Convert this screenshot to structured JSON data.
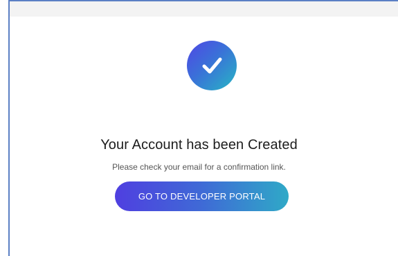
{
  "confirmation": {
    "icon": "checkmark-icon",
    "title": "Your Account has been Created",
    "message": "Please check your email for a confirmation link.",
    "button_label": "GO TO DEVELOPER PORTAL"
  },
  "colors": {
    "frame": "#5b7fc4",
    "gradient_start": "#5046e5",
    "gradient_end": "#27b6c4",
    "title_text": "#1c1c1c",
    "message_text": "#555555"
  }
}
